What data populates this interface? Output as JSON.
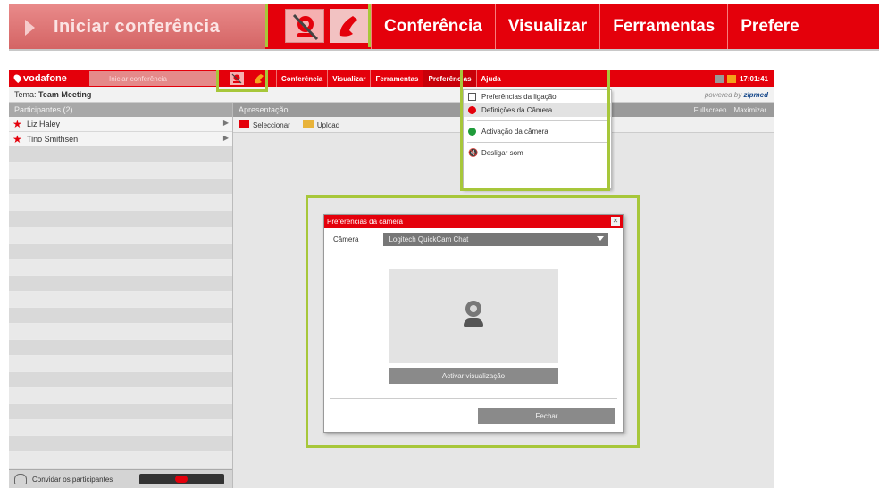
{
  "zoom": {
    "start_label": "Iniciar conferência",
    "menus": [
      "Conferência",
      "Visualizar",
      "Ferramentas",
      "Prefere"
    ]
  },
  "app": {
    "logo": "vodafone",
    "start_label": "Iniciar conferência",
    "menus": [
      "Conferência",
      "Visualizar",
      "Ferramentas",
      "Preferências",
      "Ajuda"
    ],
    "clock": "17:01:41",
    "topic_label": "Tema:",
    "topic_value": "Team Meeting",
    "powered_by": "powered by",
    "powered_brand": "zipmed"
  },
  "participants": {
    "header": "Participantes (2)",
    "items": [
      "Liz Haley",
      "Tino Smithsen"
    ],
    "invite_label": "Convidar os participantes"
  },
  "presentation": {
    "header": "Apresentação",
    "fullscreen": "Fullscreen",
    "maximize": "Maximizar",
    "select": "Seleccionar",
    "upload": "Upload"
  },
  "dropdown": {
    "items": [
      "Preferências da ligação",
      "Definições da Câmera",
      "Activação da câmera",
      "Desligar som"
    ]
  },
  "dialog": {
    "title": "Preferências da câmera",
    "camera_label": "Câmera",
    "camera_value": "Logitech QuickCam Chat",
    "activate_label": "Activar visualização",
    "close_label": "Fechar"
  },
  "colors": {
    "brand_red": "#e4000b",
    "highlight_green": "#a7c73a"
  }
}
